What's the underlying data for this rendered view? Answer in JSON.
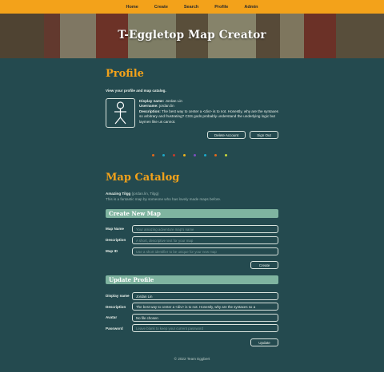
{
  "nav": {
    "items": [
      "Home",
      "Create",
      "Search",
      "Profile",
      "Admin"
    ]
  },
  "hero": {
    "title": "T-Eggletop Map Creator"
  },
  "profile": {
    "heading": "Profile",
    "intro": "View your profile and map catalog.",
    "display_name_label": "Display name:",
    "display_name": "Jordan Lin",
    "username_label": "Username:",
    "username": "jordan.lin",
    "description_label": "Description:",
    "description": "The best way to center a <div> is to not. Honestly, why are the syntaxes so arbitrary and frustrating? CSS gods probably understand the underlying logic but laymen like us cannot.",
    "delete_label": "Delete Account",
    "signout_label": "Sign Out"
  },
  "separator_colors": [
    "#e2681a",
    "#1ba8c9",
    "#c93b2a",
    "#e9b21c",
    "#7c4fc0",
    "#1ba8c9",
    "#e2681a",
    "#c7d63a"
  ],
  "catalog": {
    "heading": "Map Catalog",
    "map_title": "Amazing Tilgg",
    "map_meta": "(jordan.lin, Tilgg)",
    "map_desc": "This is a fantastic map by someone who has lovely made maps before."
  },
  "create_form": {
    "heading": "Create New Map",
    "name_label": "Map Name",
    "name_placeholder": "Your amazing adventure map's name",
    "desc_label": "Description",
    "desc_placeholder": "A short, descriptive text for your map",
    "id_label": "Map ID",
    "id_placeholder": "Use a short identifier to be unique for your new map",
    "submit_label": "Create"
  },
  "update_form": {
    "heading": "Update Profile",
    "display_label": "Display name",
    "display_value": "Jordan Lin",
    "desc_label": "Description",
    "desc_value": "The best way to center a <div> is to not. Honestly, why are the syntaxes so a",
    "avatar_label": "Avatar",
    "avatar_value": "No file chosen",
    "password_label": "Password",
    "password_placeholder": "Leave blank to keep your current password",
    "submit_label": "Update"
  },
  "footer": {
    "text": "© 2022 Team Eggbert"
  }
}
